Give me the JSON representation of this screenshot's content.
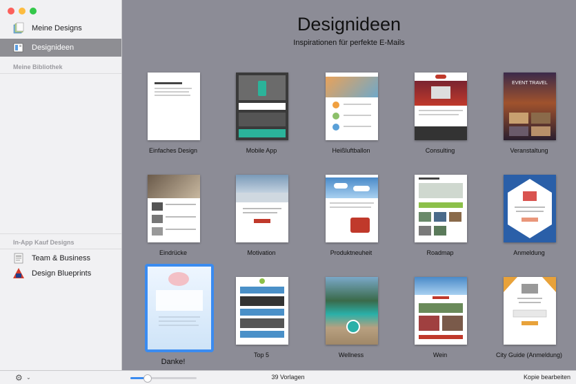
{
  "window": {
    "traffic_colors": [
      "#fc605b",
      "#fdbc40",
      "#34c84a"
    ]
  },
  "sidebar": {
    "items": [
      {
        "label": "Meine Designs",
        "icon": "designs-stack-icon"
      },
      {
        "label": "Designideen",
        "icon": "ideas-icon",
        "selected": true
      }
    ],
    "library_header": "Meine Bibliothek",
    "inapp_header": "In-App Kauf Designs",
    "inapp_items": [
      {
        "label": "Team & Business",
        "icon": "team-business-icon"
      },
      {
        "label": "Design Blueprints",
        "icon": "blueprints-icon"
      }
    ]
  },
  "main": {
    "title": "Designideen",
    "subtitle": "Inspirationen für perfekte E-Mails",
    "templates": [
      {
        "label": "Einfaches Design",
        "style": "plain"
      },
      {
        "label": "Mobile App",
        "style": "mobile"
      },
      {
        "label": "Heißluftballon",
        "style": "balloon"
      },
      {
        "label": "Consulting",
        "style": "consulting"
      },
      {
        "label": "Veranstaltung",
        "style": "event",
        "thumb_text": "EVENT TRAVEL"
      },
      {
        "label": "Eindrücke",
        "style": "impressions"
      },
      {
        "label": "Motivation",
        "style": "motivation"
      },
      {
        "label": "Produktneuheit",
        "style": "product"
      },
      {
        "label": "Roadmap",
        "style": "roadmap"
      },
      {
        "label": "Anmeldung",
        "style": "signup"
      },
      {
        "label": "Danke!",
        "style": "thanks",
        "selected": true
      },
      {
        "label": "Top 5",
        "style": "top5"
      },
      {
        "label": "Wellness",
        "style": "wellness"
      },
      {
        "label": "Wein",
        "style": "wine"
      },
      {
        "label": "City Guide (Anmeldung)",
        "style": "city"
      }
    ]
  },
  "bottombar": {
    "gear_icon": "gear-icon",
    "zoom_level": 0.25,
    "count": "39 Vorlagen",
    "edit_label": "Kopie bearbeiten"
  },
  "colors": {
    "accent": "#3a8bf0",
    "gallery_bg": "#8c8c96",
    "sidebar_selected": "#8e8e93"
  }
}
